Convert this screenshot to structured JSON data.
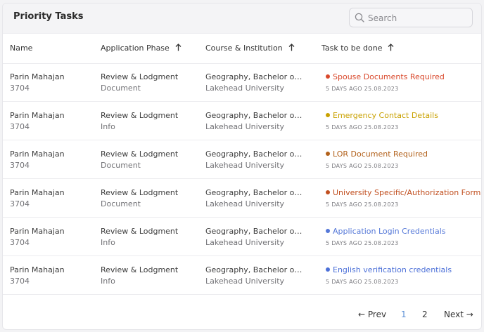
{
  "card": {
    "title": "Priority Tasks"
  },
  "search": {
    "placeholder": "Search"
  },
  "columns": {
    "name": "Name",
    "phase": "Application Phase",
    "course": "Course & Institution",
    "task": "Task to be done"
  },
  "icons": {
    "search": "search-icon",
    "sort": "arrow-up-icon",
    "prev": "arrow-left-icon",
    "next": "arrow-right-icon"
  },
  "rows": [
    {
      "name": "Parin Mahajan",
      "id": "3704",
      "phase": "Review & Lodgment",
      "sub_phase": "Document",
      "course": "Geography, Bachelor of Arts",
      "institution": "Lakehead University",
      "task": "Spouse Documents Required",
      "task_color": "#d9482b",
      "date": "5 DAYS AGO 25.08.2023"
    },
    {
      "name": "Parin Mahajan",
      "id": "3704",
      "phase": "Review & Lodgment",
      "sub_phase": "Info",
      "course": "Geography, Bachelor of Arts",
      "institution": "Lakehead University",
      "task": "Emergency Contact Details",
      "task_color": "#c9a100",
      "date": "5 DAYS AGO 25.08.2023"
    },
    {
      "name": "Parin Mahajan",
      "id": "3704",
      "phase": "Review & Lodgment",
      "sub_phase": "Document",
      "course": "Geography, Bachelor of Arts",
      "institution": "Lakehead University",
      "task": "LOR Document Required",
      "task_color": "#b2611b",
      "date": "5 DAYS AGO 25.08.2023"
    },
    {
      "name": "Parin Mahajan",
      "id": "3704",
      "phase": "Review & Lodgment",
      "sub_phase": "Document",
      "course": "Geography, Bachelor of Arts",
      "institution": "Lakehead University",
      "task": "University Specific/Authorization Form",
      "task_color": "#c14f1f",
      "date": "5 DAYS AGO 25.08.2023"
    },
    {
      "name": "Parin Mahajan",
      "id": "3704",
      "phase": "Review & Lodgment",
      "sub_phase": "Info",
      "course": "Geography, Bachelor of Arts",
      "institution": "Lakehead University",
      "task": "Application Login Credentials",
      "task_color": "#5578d8",
      "date": "5 DAYS AGO 25.08.2023"
    },
    {
      "name": "Parin Mahajan",
      "id": "3704",
      "phase": "Review & Lodgment",
      "sub_phase": "Info",
      "course": "Geography, Bachelor of Arts",
      "institution": "Lakehead University",
      "task": "English verification credentials",
      "task_color": "#4c70d8",
      "date": "5 DAYS AGO 25.08.2023"
    }
  ],
  "pagination": {
    "prev": "Prev",
    "pages": [
      "1",
      "2"
    ],
    "current": "1",
    "next": "Next"
  }
}
